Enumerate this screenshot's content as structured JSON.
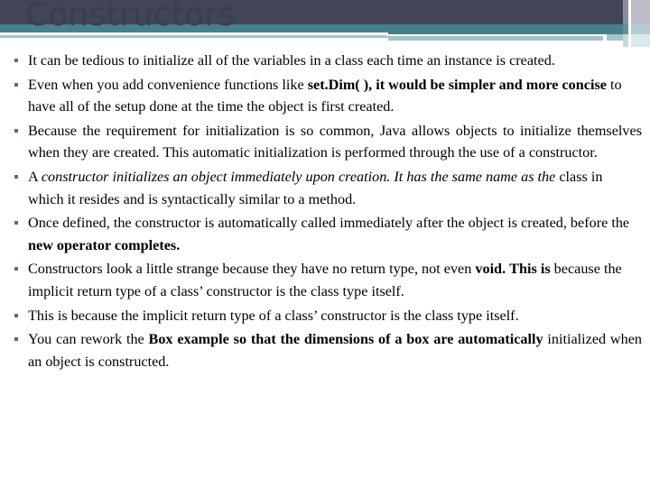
{
  "slide": {
    "title": "Constructors",
    "theme": {
      "band_dark": "#424459",
      "band_teal": "#45818a",
      "band_pale": "#a6c3ca",
      "title_color": "#3b3d52",
      "bullet_color": "#7b5c78",
      "body_text_color": "#000000",
      "background": "#ffffff"
    },
    "bullets": [
      {
        "id": "bullet-1",
        "justify": false,
        "runs": [
          {
            "text": "It can be tedious to initialize all of the variables in a class each time an instance is created.",
            "style": "normal"
          }
        ]
      },
      {
        "id": "bullet-2",
        "justify": false,
        "runs": [
          {
            "text": "Even when you add convenience functions like ",
            "style": "normal"
          },
          {
            "text": "set.Dim( ), it would be simpler and more concise",
            "style": "bold"
          },
          {
            "text": " to have all of the setup done at the time the object is first created.",
            "style": "normal"
          }
        ]
      },
      {
        "id": "bullet-3",
        "justify": true,
        "runs": [
          {
            "text": "Because the requirement for initialization is so common, Java allows objects to initialize themselves when they are created. This automatic initialization is performed through the use of a constructor.",
            "style": "normal"
          }
        ]
      },
      {
        "id": "bullet-4",
        "justify": false,
        "runs": [
          {
            "text": "A ",
            "style": "normal"
          },
          {
            "text": "constructor initializes an object immediately upon creation. It has the same name as the",
            "style": "italic"
          },
          {
            "text": " class in which it resides and is syntactically similar to a method.",
            "style": "normal"
          }
        ]
      },
      {
        "id": "bullet-5",
        "justify": false,
        "runs": [
          {
            "text": "Once defined, the constructor is automatically called immediately after the object is created, before the ",
            "style": "normal"
          },
          {
            "text": "new operator completes.",
            "style": "bold"
          }
        ]
      },
      {
        "id": "bullet-6",
        "justify": false,
        "runs": [
          {
            "text": "Constructors look a little strange because they have no return type, not even ",
            "style": "normal"
          },
          {
            "text": "void.",
            "style": "bold"
          },
          {
            "text": " ",
            "style": "normal"
          },
          {
            "text": "This is",
            "style": "bold"
          },
          {
            "text": " because the implicit return type of a class’ constructor is the class type itself.",
            "style": "normal"
          }
        ]
      },
      {
        "id": "bullet-7",
        "justify": false,
        "runs": [
          {
            "text": "This is because the implicit return type of a class’ constructor is the class type itself.",
            "style": "normal"
          }
        ]
      },
      {
        "id": "bullet-8",
        "justify": true,
        "runs": [
          {
            "text": "You can rework the ",
            "style": "normal"
          },
          {
            "text": "Box example so that the dimensions of a box are automatically",
            "style": "bold"
          },
          {
            "text": " initialized when an object is constructed.",
            "style": "normal"
          }
        ]
      }
    ]
  }
}
